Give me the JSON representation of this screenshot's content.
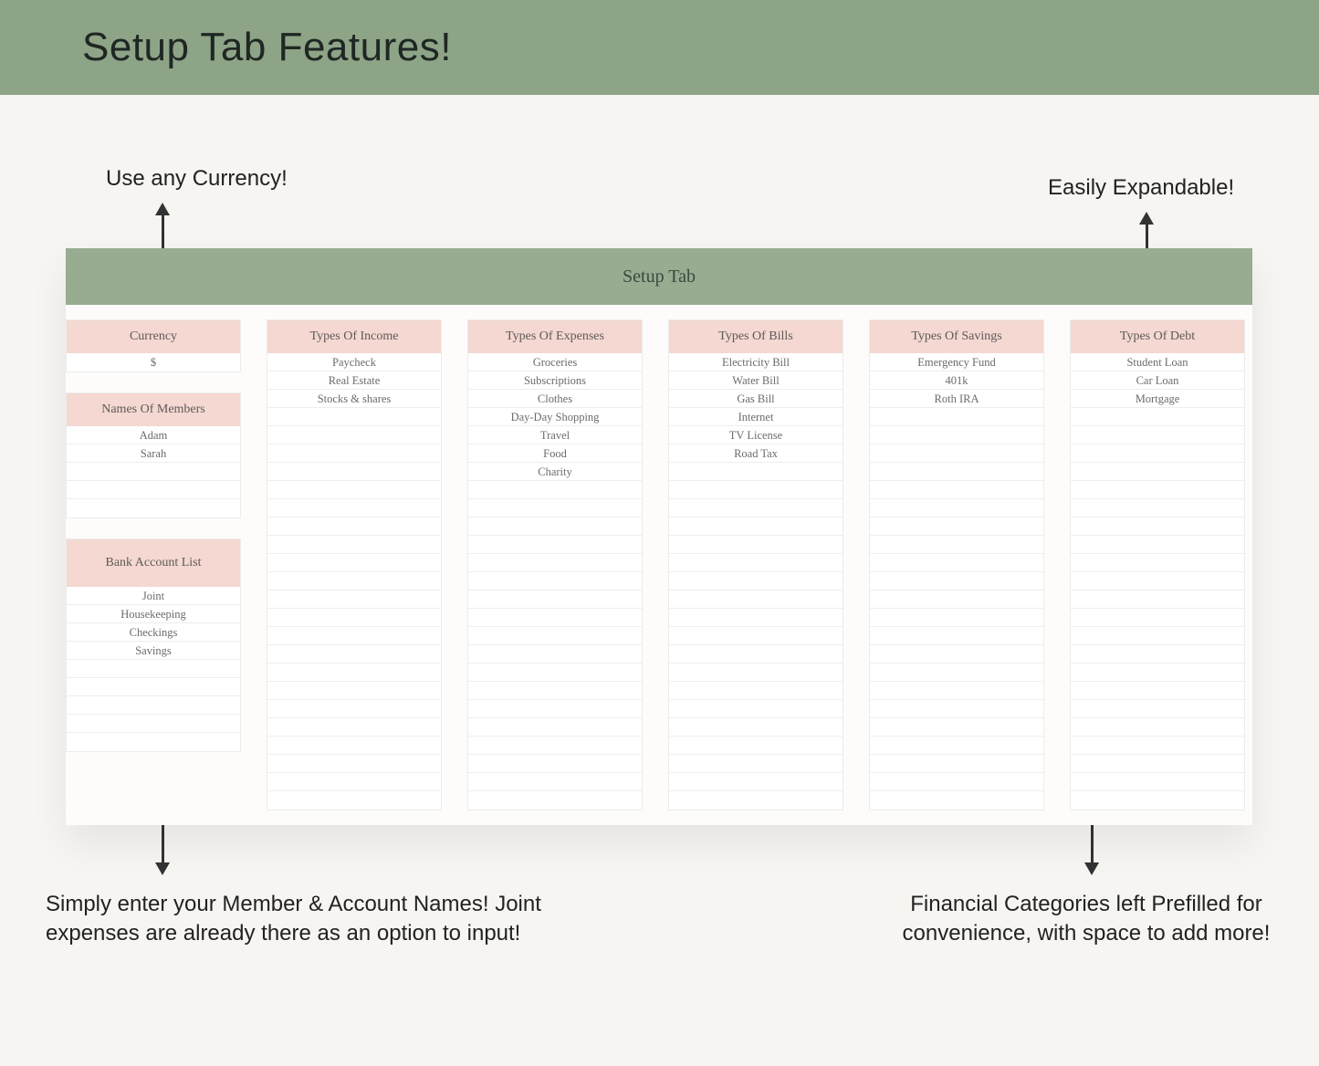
{
  "banner_title": "Setup Tab Features!",
  "callouts": {
    "top_left": "Use any Currency!",
    "top_right": "Easily Expandable!",
    "bottom_left": "Simply enter your Member & Account Names! Joint expenses are already there as an option to input!",
    "bottom_right": "Financial Categories left Prefilled for convenience, with space to add more!"
  },
  "panel": {
    "title": "Setup Tab",
    "currency_header": "Currency",
    "currency_value": "$",
    "members_header": "Names Of Members",
    "members": [
      "Adam",
      "Sarah"
    ],
    "bank_header": "Bank Account List",
    "bank_accounts": [
      "Joint",
      "Housekeeping",
      "Checkings",
      "Savings"
    ],
    "columns": [
      {
        "header": "Types Of Income",
        "items": [
          "Paycheck",
          "Real Estate",
          "Stocks & shares"
        ]
      },
      {
        "header": "Types Of Expenses",
        "items": [
          "Groceries",
          "Subscriptions",
          "Clothes",
          "Day-Day Shopping",
          "Travel",
          "Food",
          "Charity"
        ]
      },
      {
        "header": "Types Of Bills",
        "items": [
          "Electricity Bill",
          "Water Bill",
          "Gas Bill",
          "Internet",
          "TV License",
          "Road Tax"
        ]
      },
      {
        "header": "Types Of Savings",
        "items": [
          "Emergency Fund",
          "401k",
          "Roth IRA"
        ]
      },
      {
        "header": "Types Of Debt",
        "items": [
          "Student Loan",
          "Car Loan",
          "Mortgage"
        ]
      }
    ]
  }
}
